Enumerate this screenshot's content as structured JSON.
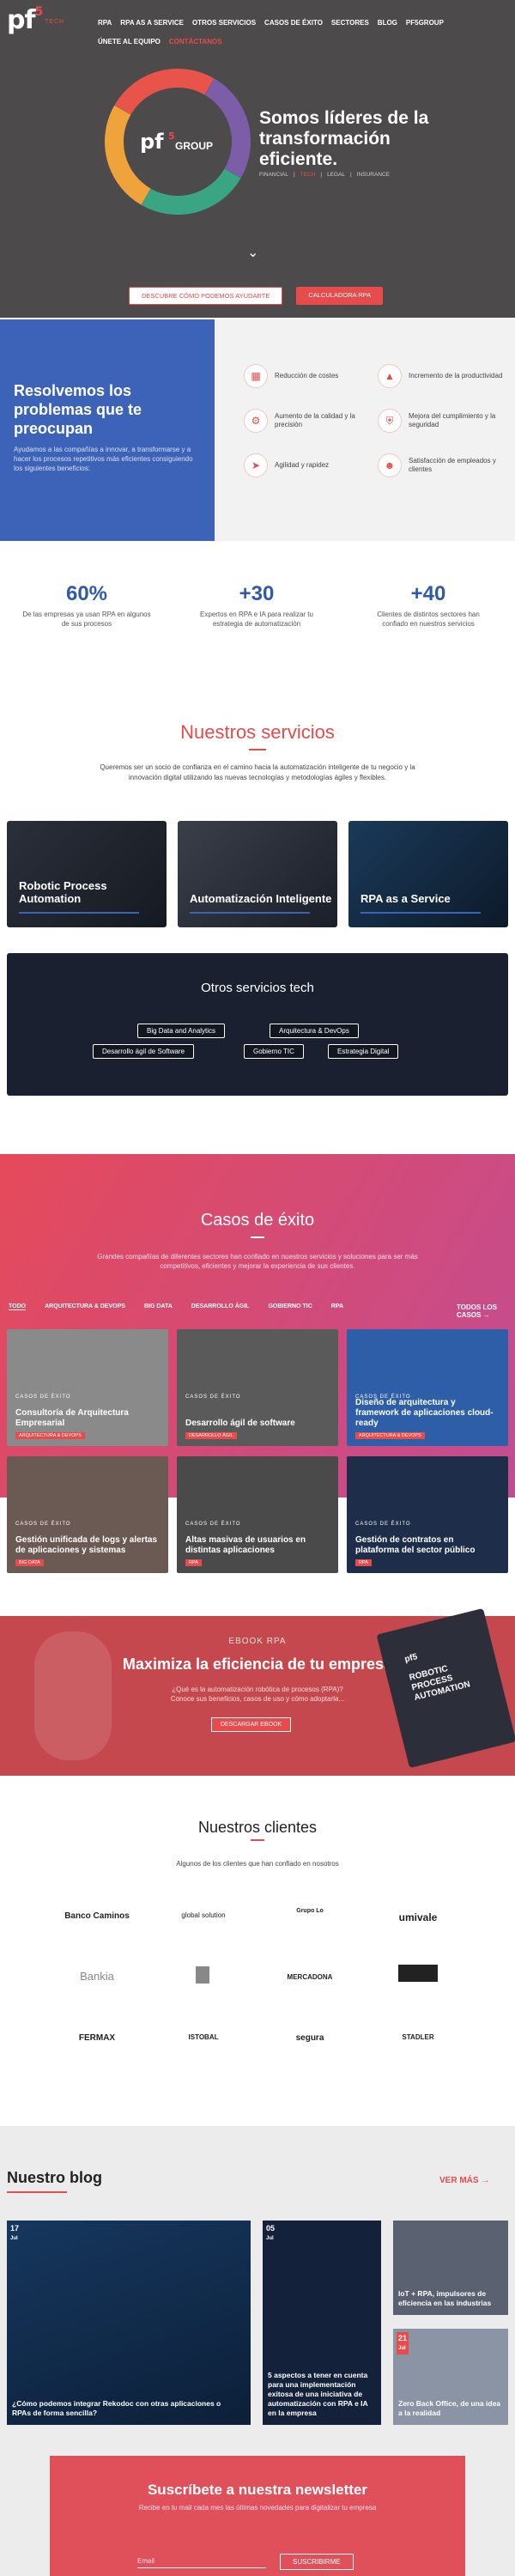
{
  "header": {
    "logo": "pf",
    "logo_sup": "5",
    "logo_tag": "TECH",
    "nav_row1": [
      "RPA",
      "RPA AS A SERVICE",
      "OTROS SERVICIOS",
      "CASOS DE ÉXITO",
      "SECTORES",
      "BLOG",
      "PF5GROUP"
    ],
    "nav_row2": [
      "ÚNETE AL EQUIPO",
      "CONTÁCTANOS"
    ]
  },
  "hero": {
    "ring_logo": "pf",
    "ring_logo_sup": "5",
    "ring_group": "GROUP",
    "title": "Somos líderes de la transformación eficiente.",
    "tags": [
      "FINANCIAL",
      "TECH",
      "LEGAL",
      "INSURANCE"
    ],
    "scroll_icon": "chevron-down-icon",
    "cta_primary": "DESCUBRE CÓMO PODEMOS AYUDARTE",
    "cta_secondary": "CALCULADORA RPA"
  },
  "intro": {
    "title": "Resolvemos los problemas que te preocupan",
    "text": "Ayudamos a las compañías a innovar, a transformarse y a hacer los procesos repetitivos más eficientes consiguiendo los siguientes beneficios:",
    "benefits": [
      {
        "icon": "document-icon",
        "label": "Reducción de costes"
      },
      {
        "icon": "chart-icon",
        "label": "Incremento de la productividad"
      },
      {
        "icon": "gear-icon",
        "label": "Aumento de la calidad y la precisión"
      },
      {
        "icon": "shield-icon",
        "label": "Mejora del cumplimiento y la seguridad"
      },
      {
        "icon": "rocket-icon",
        "label": "Agilidad y rapidez"
      },
      {
        "icon": "people-icon",
        "label": "Satisfacción de empleados y clientes"
      }
    ]
  },
  "stats": [
    {
      "value": "60%",
      "text": "De las empresas ya usan RPA en algunos de sus procesos"
    },
    {
      "value": "+30",
      "text": "Expertos en RPA e IA para realizar tu estrategia de automatización"
    },
    {
      "value": "+40",
      "text": "Clientes de distintos sectores han confiado en nuestros servicios"
    }
  ],
  "services": {
    "title": "Nuestros servicios",
    "subtitle": "Queremos ser un socio de confianza en el camino hacia la automatización inteligente de tu negocio y la innovación digital utilizando las nuevas tecnologías y metodologías ágiles y flexibles.",
    "cards": [
      "Robotic Process Automation",
      "Automatización Inteligente",
      "RPA as a Service"
    ],
    "other_title": "Otros servicios tech",
    "other_items": [
      "Big Data and Analytics",
      "Arquitectura & DevOps",
      "Desarrollo ágil de Software",
      "Gobierno TIC",
      "Estrategia Digital"
    ]
  },
  "cases": {
    "title": "Casos de éxito",
    "subtitle": "Grandes compañías de diferentes sectores han confiado en nuestros servicios y soluciones para ser más competitivos, eficientes y mejorar la experiencia de sus clientes.",
    "tabs": [
      "TODO",
      "ARQUITECTURA & DEVOPS",
      "BIG DATA",
      "DESARROLLO ÁGIL",
      "GOBIERNO TIC",
      "RPA"
    ],
    "all_label": "TODOS LOS CASOS",
    "kicker": "CASOS DE ÉXITO",
    "items": [
      {
        "title": "Consultoría de Arquitectura Empresarial",
        "tag": "ARQUITECTURA & DEVOPS",
        "bg": "#8a8a8a"
      },
      {
        "title": "Desarrollo ágil de software",
        "tag": "DESARROLLO ÁGIL",
        "bg": "#5a5a5a"
      },
      {
        "title": "Diseño de arquitectura y framework de aplicaciones cloud-ready",
        "tag": "ARQUITECTURA & DEVOPS",
        "bg": "#2e5ea8"
      },
      {
        "title": "Gestión unificada de logs y alertas de aplicaciones y sistemas",
        "tag": "BIG DATA",
        "bg": "#6b5a54"
      },
      {
        "title": "Altas masivas de usuarios en distintas aplicaciones",
        "tag": "RPA",
        "bg": "#4a4a4a"
      },
      {
        "title": "Gestión de contratos en plataforma del sector público",
        "tag": "RPA",
        "bg": "#1e2e4a"
      }
    ]
  },
  "ebook": {
    "kicker": "EBOOK RPA",
    "title": "Maximiza la eficiencia de tu empresa",
    "subtitle": "¿Qué es la automatización robótica de procesos (RPA)? Conoce sus beneficios, casos de uso y cómo adoptarla...",
    "button": "DESCARGAR EBOOK",
    "book_title": "ROBOTIC PROCESS AUTOMATION",
    "book_logo": "pf5"
  },
  "clients": {
    "title": "Nuestros clientes",
    "subtitle": "Algunos de los clientes que han confiado en nosotros",
    "logos": [
      "Banco Caminos",
      "global solution",
      "Grupo Lo",
      "umivale",
      "Bankia",
      "",
      "MERCADONA",
      "",
      "FERMAX",
      "ISTOBAL",
      "segura",
      "STADLER"
    ]
  },
  "blog": {
    "title": "Nuestro blog",
    "more": "VER MÁS",
    "posts": [
      {
        "day": "17",
        "month": "Jul",
        "title": "¿Cómo podemos integrar Rekodoc con otras aplicaciones o RPAs de forma sencilla?"
      },
      {
        "day": "05",
        "month": "Jul",
        "title": "5 aspectos a tener en cuenta para una implementación exitosa de una iniciativa de automatización con RPA e IA en la empresa"
      },
      {
        "day": "",
        "month": "",
        "title": "IoT + RPA, impulsores de eficiencia en las industrias"
      },
      {
        "day": "21",
        "month": "Jul",
        "title": "Zero Back Office, de una idea a la realidad"
      }
    ]
  },
  "newsletter": {
    "title": "Suscríbete a nuestra newsletter",
    "subtitle": "Recibe en tu mail cada mes las últimas novedades para digitalizar tu empresa",
    "placeholder": "Email",
    "button": "SUSCRIBIRME"
  },
  "colors": {
    "accent": "#e74b4b",
    "blue": "#3d63b8",
    "dark": "#4c4a4b"
  }
}
